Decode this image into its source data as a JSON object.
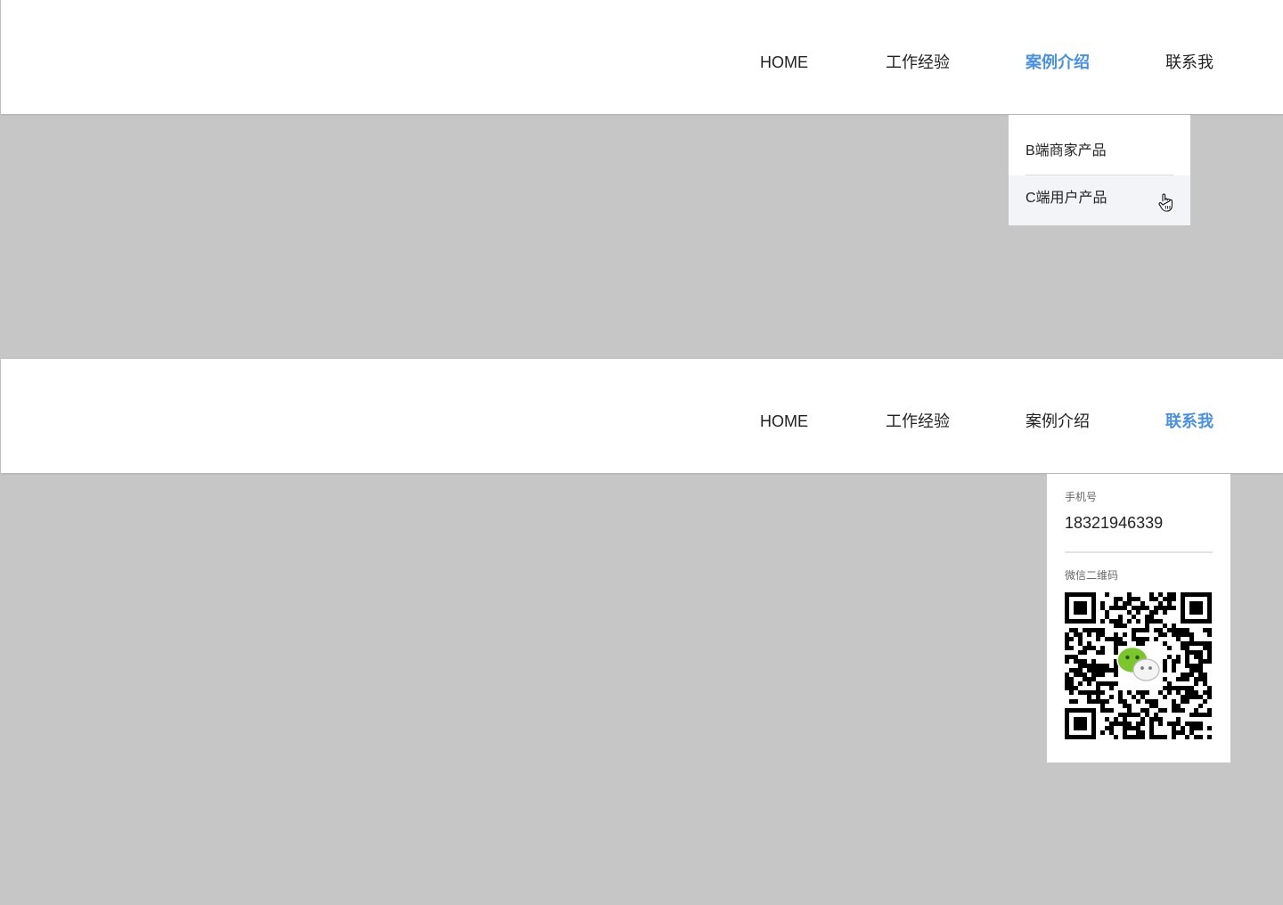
{
  "nav": {
    "home": "HOME",
    "work": "工作经验",
    "cases": "案例介绍",
    "contact": "联系我"
  },
  "accent_color": "#4a90e2",
  "top_state": {
    "active_item": "cases",
    "dropdown": {
      "items": [
        {
          "label": "B端商家产品",
          "hovered": false
        },
        {
          "label": "C端用户产品",
          "hovered": true
        }
      ]
    }
  },
  "bottom_state": {
    "active_item": "contact",
    "contact_panel": {
      "phone_label": "手机号",
      "phone": "18321946339",
      "qr_label": "微信二维码",
      "qr_icon": "wechat-qr-code"
    }
  }
}
